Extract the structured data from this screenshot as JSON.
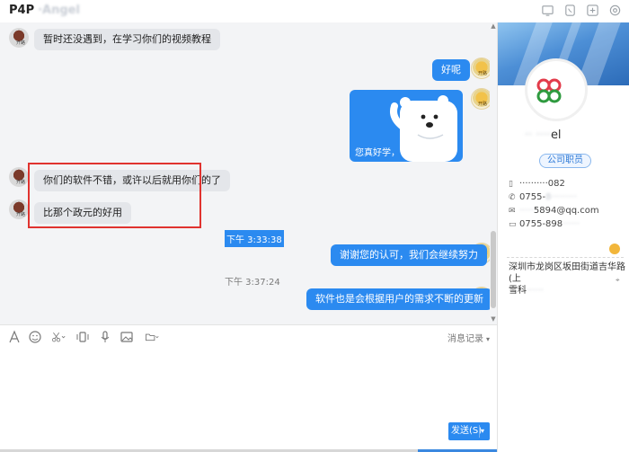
{
  "window": {
    "title": "P4P",
    "title_masked": "·Angel"
  },
  "titlebar_icons": [
    "screen-share-icon",
    "phone-icon",
    "add-icon",
    "settings-icon"
  ],
  "messages": {
    "m1": "暂时还没遇到，在学习你们的视频教程",
    "m2": "好呢",
    "m3": "您真好学，",
    "m4": "你们的软件不错，或许以后就用你们的了",
    "m5": "比那个政元的好用",
    "t1": "下午 3:33:38",
    "m6": "谢谢您的认可，我们会继续努力",
    "t2": "下午 3:37:24",
    "m7": "软件也是会根据用户的需求不断的更新"
  },
  "avatar_mini_left": "开路",
  "avatar_mini_right": "开路",
  "toolbar": {
    "history": "消息记录",
    "icons": [
      "font-icon",
      "emoji-icon",
      "scissors-icon",
      "vibrate-icon",
      "microphone-icon",
      "image-icon",
      "folder-icon"
    ]
  },
  "send_button": "发送(S)",
  "profile": {
    "name_masked": "·· ····",
    "name_suffix": "el",
    "role": "公司职员",
    "mobile": "··········082",
    "phone1": "0755-",
    "phone1_masked": "8·········",
    "email_masked": "·····",
    "email": "5894@qq.com",
    "phone2": "0755-898",
    "phone2_masked": "······",
    "address": "深圳市龙岗区坂田街道吉华路(上",
    "address_line2": "雪科",
    "address_masked": "······"
  },
  "colors": {
    "accent": "#2b8af0",
    "highlight_border": "#e0332f"
  }
}
